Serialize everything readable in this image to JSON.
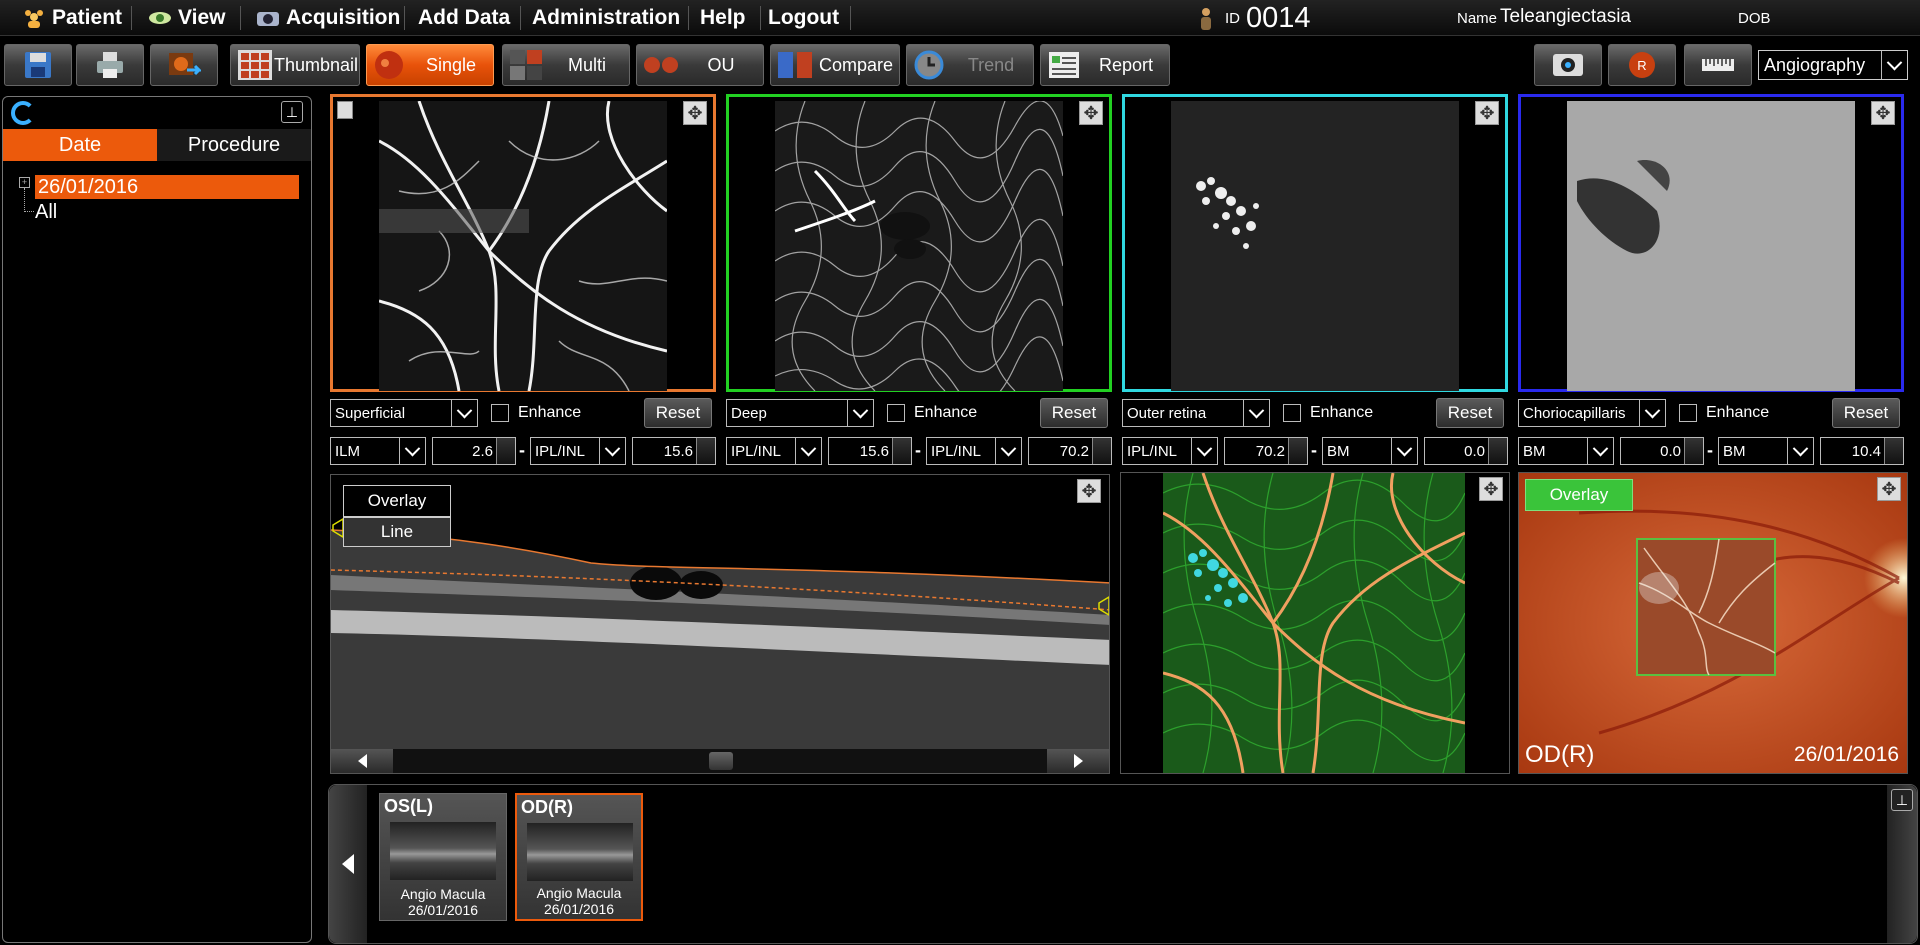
{
  "menu": {
    "patient": "Patient",
    "view": "View",
    "acquisition": "Acquisition",
    "add_data": "Add Data",
    "administration": "Administration",
    "help": "Help",
    "logout": "Logout"
  },
  "patient_info": {
    "id_label": "ID",
    "id_value": "0014",
    "name_label": "Name",
    "name_value": "Teleangiectasia",
    "dob_label": "DOB"
  },
  "toolbar": {
    "thumbnail": "Thumbnail",
    "single": "Single",
    "multi": "Multi",
    "ou": "OU",
    "compare": "Compare",
    "trend": "Trend",
    "report": "Report",
    "mode_select": "Angiography"
  },
  "left_panel": {
    "tab_date": "Date",
    "tab_procedure": "Procedure",
    "tree_date": "26/01/2016",
    "tree_all": "All"
  },
  "angio_panels": [
    {
      "layer": "Superficial",
      "enhance": "Enhance",
      "reset": "Reset",
      "upper_ref": "ILM",
      "upper_val": "2.6",
      "lower_ref": "IPL/INL",
      "lower_val": "15.6",
      "color": "#e87830"
    },
    {
      "layer": "Deep",
      "enhance": "Enhance",
      "reset": "Reset",
      "upper_ref": "IPL/INL",
      "upper_val": "15.6",
      "lower_ref": "IPL/INL",
      "lower_val": "70.2",
      "color": "#22d022"
    },
    {
      "layer": "Outer retina",
      "enhance": "Enhance",
      "reset": "Reset",
      "upper_ref": "IPL/INL",
      "upper_val": "70.2",
      "lower_ref": "BM",
      "lower_val": "0.0",
      "color": "#30d8e0"
    },
    {
      "layer": "Choriocapillaris",
      "enhance": "Enhance",
      "reset": "Reset",
      "upper_ref": "BM",
      "upper_val": "0.0",
      "lower_ref": "BM",
      "lower_val": "10.4",
      "color": "#2a2aee"
    }
  ],
  "separator": "-",
  "bscan": {
    "overlay": "Overlay",
    "line": "Line"
  },
  "fundus": {
    "overlay": "Overlay",
    "eye": "OD(R)",
    "date": "26/01/2016"
  },
  "thumbnails": [
    {
      "eye": "OS(L)",
      "type": "Angio Macula",
      "date": "26/01/2016"
    },
    {
      "eye": "OD(R)",
      "type": "Angio Macula",
      "date": "26/01/2016"
    }
  ],
  "colors": {
    "accent": "#ec5a0c",
    "fundus_overlay": "#3ac43a"
  }
}
